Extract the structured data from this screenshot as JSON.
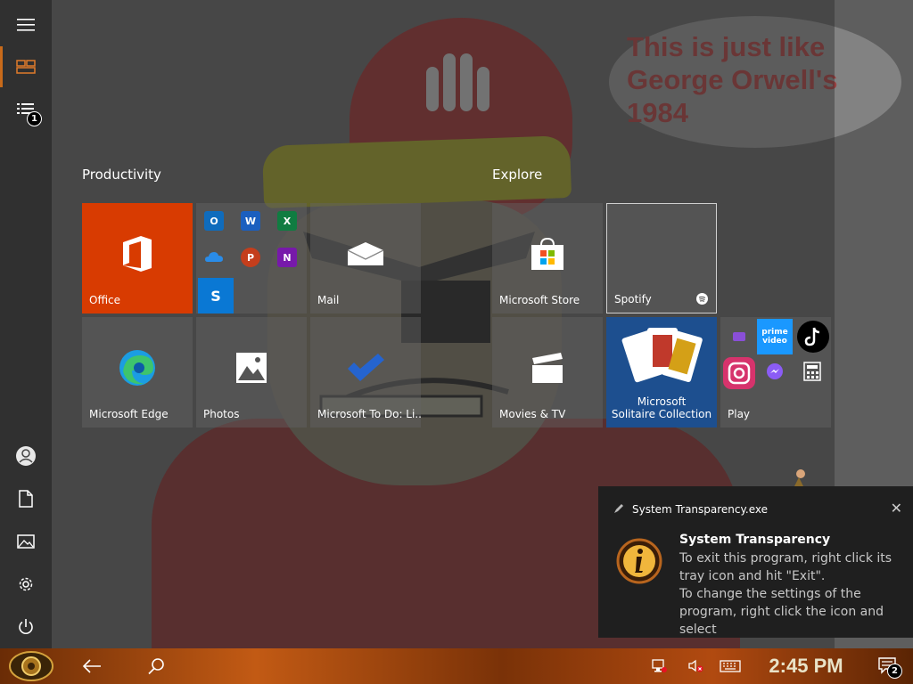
{
  "wallpaper": {
    "speech_bubble": "This is just like\nGeorge Orwell's\n1984"
  },
  "start_menu": {
    "rail": {
      "top": [
        {
          "name": "menu",
          "icon": "hamburger-icon"
        },
        {
          "name": "all-tiles",
          "icon": "tiles-icon",
          "active": true
        },
        {
          "name": "all-apps",
          "icon": "app-list-icon",
          "badge": "1"
        }
      ],
      "bottom": [
        {
          "name": "account",
          "icon": "user-icon"
        },
        {
          "name": "documents",
          "icon": "document-icon"
        },
        {
          "name": "pictures",
          "icon": "pictures-icon"
        },
        {
          "name": "settings",
          "icon": "gear-icon"
        },
        {
          "name": "power",
          "icon": "power-icon"
        }
      ]
    },
    "groups": [
      {
        "title": "Productivity"
      },
      {
        "title": "Explore"
      }
    ],
    "tiles": {
      "office": "Office",
      "mail": "Mail",
      "microsoft_store": "Microsoft Store",
      "spotify": "Spotify",
      "edge": "Microsoft Edge",
      "photos": "Photos",
      "todo": "Microsoft To Do: Li...",
      "movies": "Movies & TV",
      "solitaire": "Microsoft\nSolitaire Collection",
      "play": "Play"
    },
    "office_mini": [
      "O",
      "W",
      "X",
      "",
      "P",
      "N",
      "S"
    ],
    "play_mini": {
      "prime": "prime\nvideo"
    },
    "accent_color": "#d83b01"
  },
  "notification": {
    "app_name": "System Transparency.exe",
    "title": "System Transparency",
    "body": "To exit this program, right click its tray icon and hit \"Exit\".\nTo change the settings of the program, right click the icon and select",
    "close_icon": "close-icon",
    "app_icon": "info-icon"
  },
  "taskbar": {
    "clock": "2:45 PM",
    "notification_count": "2",
    "buttons": [
      "start-button",
      "back-button",
      "search-button"
    ],
    "tray": [
      "network-icon",
      "volume-muted-icon",
      "keyboard-icon"
    ]
  }
}
